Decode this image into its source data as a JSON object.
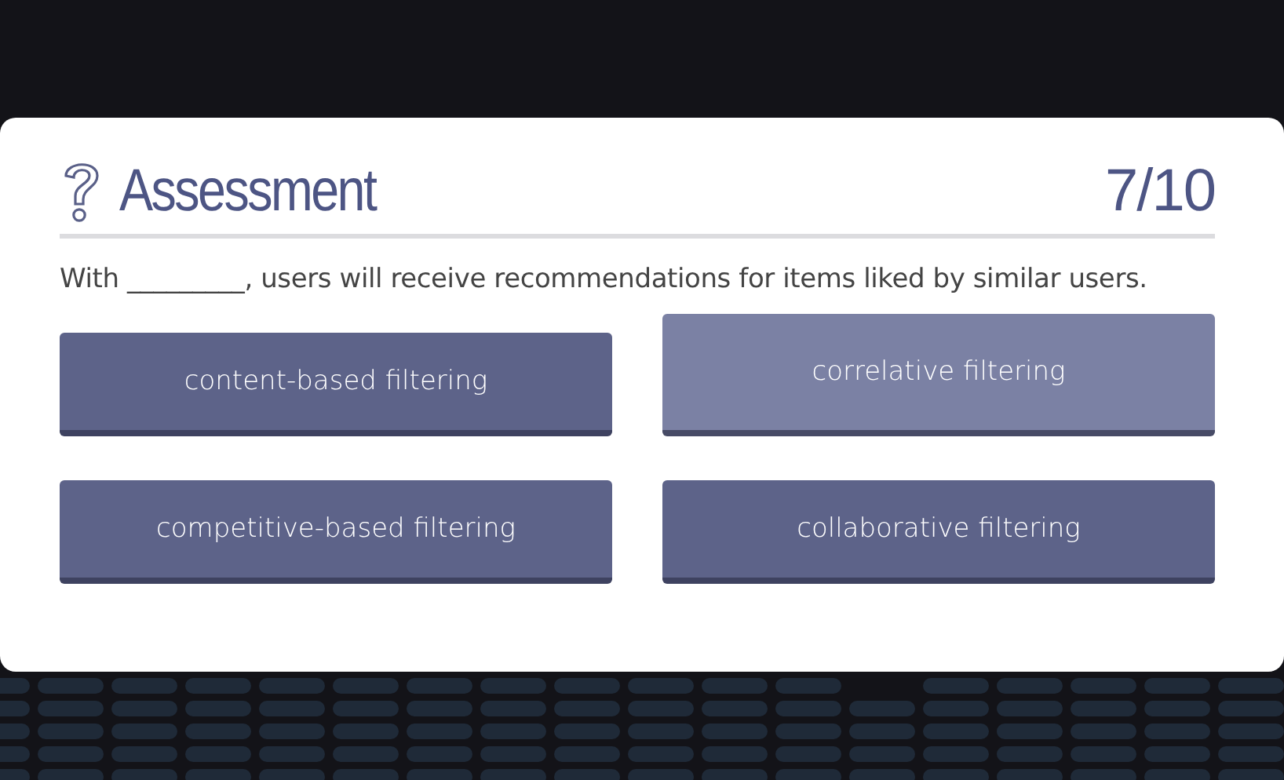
{
  "header": {
    "title": "Assessment",
    "progress": "7/10"
  },
  "question": "With _________, users will receive recommendations for items liked by similar users.",
  "answers": [
    {
      "label": "content-based filtering",
      "hovered": false
    },
    {
      "label": "correlative filtering",
      "hovered": true
    },
    {
      "label": "competitive-based filtering",
      "hovered": false
    },
    {
      "label": "collaborative filtering",
      "hovered": false
    }
  ]
}
